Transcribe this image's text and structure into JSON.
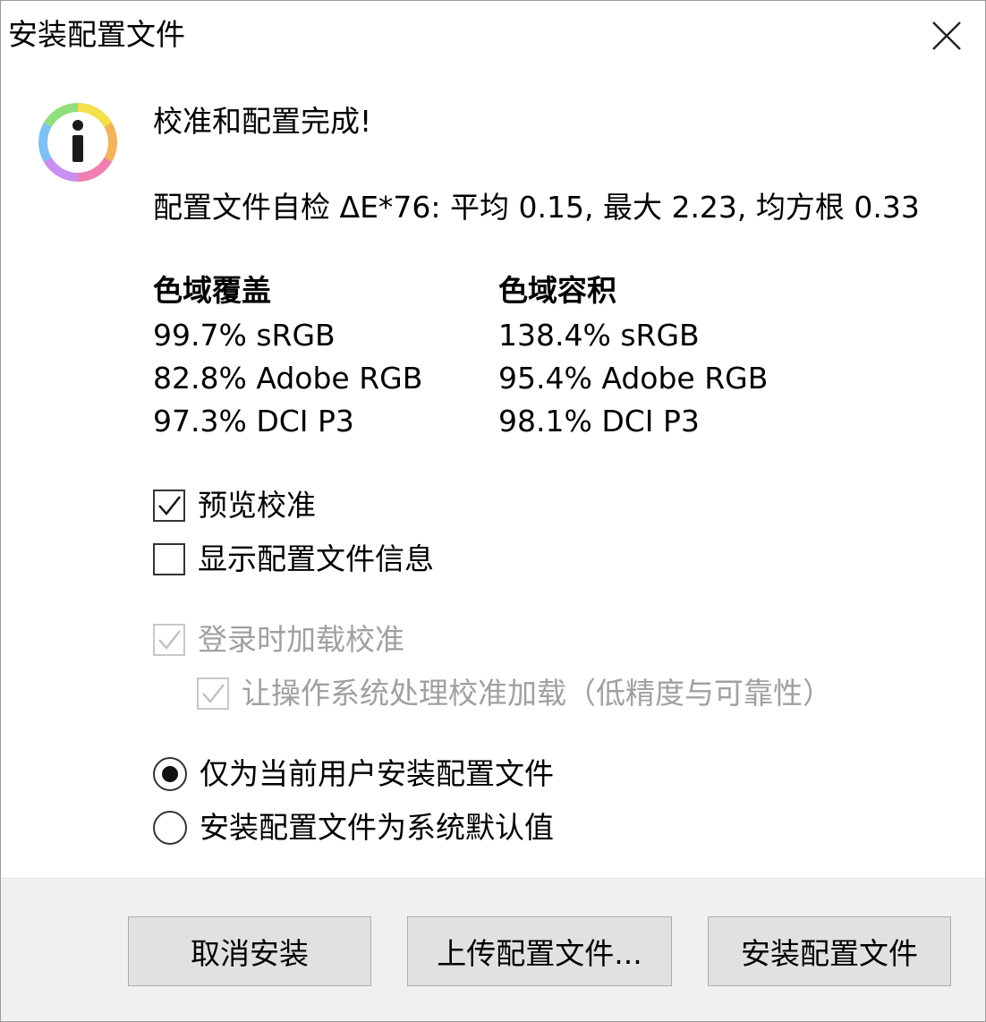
{
  "window": {
    "title": "安装配置文件"
  },
  "icons": {
    "info": "info-icon",
    "close": "close-icon",
    "check": "checkmark-icon"
  },
  "colors": {
    "footer_bg": "#f0f0f0",
    "button_bg": "#e1e1e1",
    "disabled_text": "#a0a0a0"
  },
  "message": {
    "title": "校准和配置完成!",
    "self_check": "配置文件自检 ΔE*76: 平均 0.15, 最大 2.23, 均方根 0.33"
  },
  "gamut": {
    "coverage": {
      "heading": "色域覆盖",
      "lines": [
        "99.7% sRGB",
        "82.8% Adobe RGB",
        "97.3% DCI P3"
      ]
    },
    "volume": {
      "heading": "色域容积",
      "lines": [
        "138.4% sRGB",
        "95.4% Adobe RGB",
        "98.1% DCI P3"
      ]
    }
  },
  "options": {
    "preview_calibration": {
      "label": "预览校准",
      "checked": true,
      "enabled": true
    },
    "show_profile_info": {
      "label": "显示配置文件信息",
      "checked": false,
      "enabled": true
    },
    "load_on_login": {
      "label": "登录时加载校准",
      "checked": true,
      "enabled": false
    },
    "os_handles_loading": {
      "label": "让操作系统处理校准加载（低精度与可靠性）",
      "checked": true,
      "enabled": false
    }
  },
  "install_scope": {
    "current_user": {
      "label": "仅为当前用户安装配置文件",
      "selected": true
    },
    "system_default": {
      "label": "安装配置文件为系统默认值",
      "selected": false
    }
  },
  "buttons": {
    "cancel": "取消安装",
    "upload": "上传配置文件...",
    "install": "安装配置文件"
  }
}
